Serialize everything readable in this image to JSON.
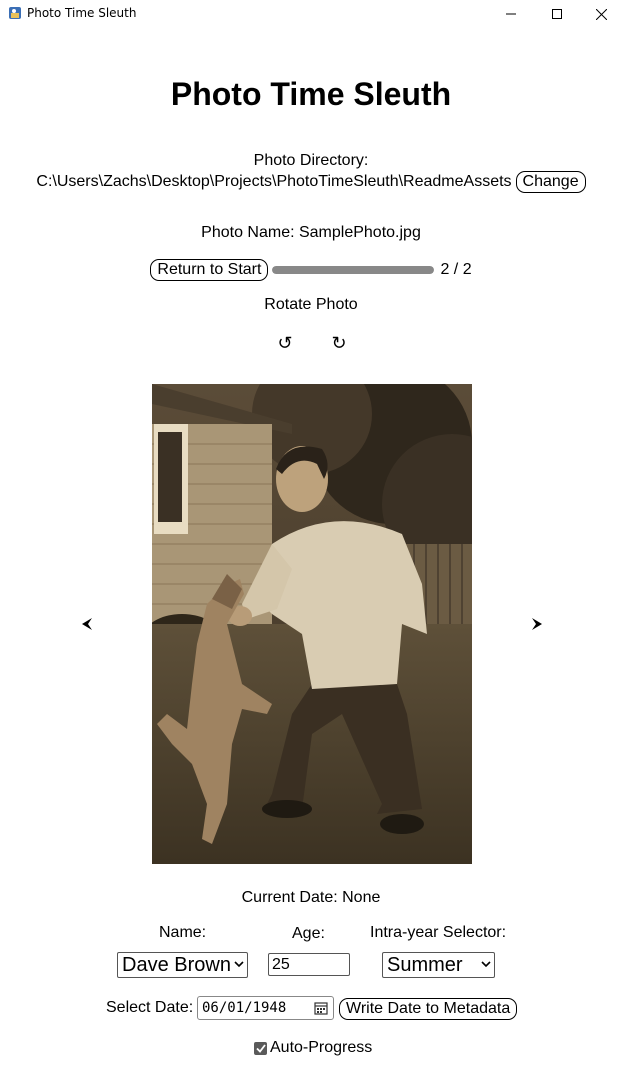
{
  "window": {
    "title": "Photo Time Sleuth"
  },
  "header": {
    "title": "Photo Time Sleuth"
  },
  "directory": {
    "label": "Photo Directory:",
    "path": "C:\\Users\\Zachs\\Desktop\\Projects\\PhotoTimeSleuth\\ReadmeAssets",
    "change_label": "Change"
  },
  "photo": {
    "name_text": "Photo Name: SamplePhoto.jpg"
  },
  "progress": {
    "return_label": "Return to Start",
    "counter": "2 / 2",
    "fraction": 1.0
  },
  "rotate": {
    "label": "Rotate Photo",
    "left_glyph": "↺",
    "right_glyph": "↻"
  },
  "metadata": {
    "current_date_text": "Current Date: None",
    "name_label": "Name:",
    "name_value": "Dave Brown",
    "age_label": "Age:",
    "age_value": "25",
    "intra_year_label": "Intra-year Selector:",
    "intra_year_value": "Summer",
    "select_date_label": "Select Date:",
    "date_value": "06/01/1948",
    "write_label": "Write Date to Metadata",
    "auto_progress_label": "Auto-Progress",
    "auto_progress_checked": true
  }
}
